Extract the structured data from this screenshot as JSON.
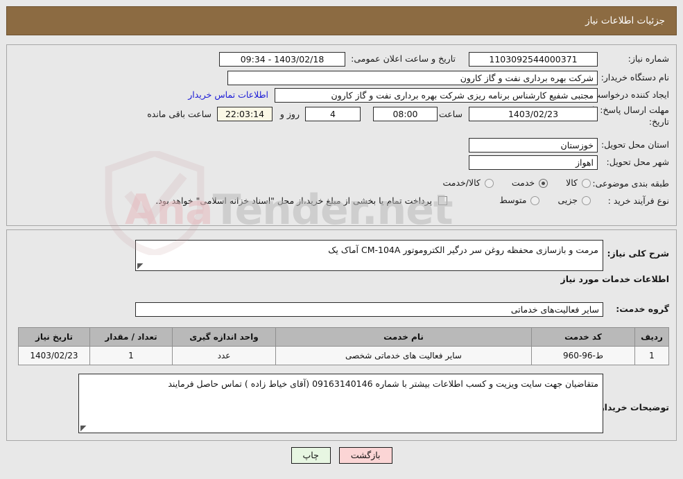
{
  "header": {
    "title": "جزئیات اطلاعات نیاز"
  },
  "watermark": {
    "text_a": "Ana",
    "text_b": "Tender",
    "text_c": ".net"
  },
  "top_panel": {
    "need_number_label": "شماره نیاز:",
    "need_number_value": "1103092544000371",
    "announce_label": "تاریخ و ساعت اعلان عمومی:",
    "announce_value": "1403/02/18 - 09:34",
    "buyer_org_label": "نام دستگاه خریدار:",
    "buyer_org_value": "شرکت بهره برداری نفت و گاز کارون",
    "requester_label": "ایجاد کننده درخواست:",
    "requester_value": "مجتبی شفیع کارشناس برنامه ریزی شرکت بهره برداری نفت و گاز کارون",
    "contact_link": "اطلاعات تماس خریدار",
    "deadline_label_line1": "مهلت ارسال پاسخ: تا",
    "deadline_label_line2": "تاریخ:",
    "deadline_date": "1403/02/23",
    "time_label": "ساعت",
    "deadline_time": "08:00",
    "days_value": "4",
    "days_label": "روز و",
    "countdown_value": "22:03:14",
    "remaining_label": "ساعت باقی مانده",
    "province_label": "استان محل تحویل:",
    "province_value": "خوزستان",
    "city_label": "شهر محل تحویل:",
    "city_value": "اهواز",
    "category_label": "طبقه بندی موضوعی:",
    "category_options": [
      {
        "label": "کالا",
        "selected": false
      },
      {
        "label": "خدمت",
        "selected": true
      },
      {
        "label": "کالا/خدمت",
        "selected": false
      }
    ],
    "process_label": "نوع فرآیند خرید :",
    "process_options": [
      {
        "label": "جزیی",
        "selected": false
      },
      {
        "label": "متوسط",
        "selected": false
      }
    ],
    "treasury_note": "پرداخت تمام یا بخشی از مبلغ خرید،از محل \"اسناد خزانه اسلامی\" خواهد بود."
  },
  "mid_panel": {
    "general_desc_label": "شرح کلی نیاز:",
    "general_desc_value": "مرمت و بازسازی محفظه روغن سر درگیر الکتروموتور CM-104A آماک یک",
    "services_section_title": "اطلاعات خدمات مورد نیاز",
    "service_group_label": "گروه خدمت:",
    "service_group_value": "سایر فعالیت‌های خدماتی",
    "table": {
      "columns": [
        "ردیف",
        "کد خدمت",
        "نام خدمت",
        "واحد اندازه گیری",
        "تعداد / مقدار",
        "تاریخ نیاز"
      ],
      "rows": [
        [
          "1",
          "ط-96-960",
          "سایر فعالیت های خدماتی شخصی",
          "عدد",
          "1",
          "1403/02/23"
        ]
      ]
    },
    "buyer_notes_label": "توضیحات خریدار:",
    "buyer_notes_value": "متقاضیان جهت سایت ویزیت و کسب اطلاعات بیشتر با شماره 09163140146 (آقای خیاط زاده ) تماس حاصل فرمایند"
  },
  "footer": {
    "print_button": "چاپ",
    "back_button": "بازگشت"
  }
}
